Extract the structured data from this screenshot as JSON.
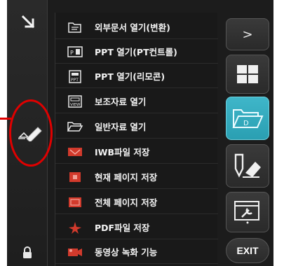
{
  "menu": {
    "items": [
      {
        "label": "외부문서 열기(변환)",
        "icon": "open-external-doc-icon"
      },
      {
        "label": "PPT 열기(PT컨트롤)",
        "icon": "ppt-control-icon"
      },
      {
        "label": "PPT 열기(리모콘)",
        "icon": "ppt-remote-icon"
      },
      {
        "label": "보조자료 열기",
        "icon": "supplementary-material-icon"
      },
      {
        "label": "일반자료 열기",
        "icon": "folder-icon"
      },
      {
        "label": "IWB파일 저장",
        "icon": "iwb-file-icon"
      },
      {
        "label": "현재 페이지 저장",
        "icon": "current-page-save-icon"
      },
      {
        "label": "전체 페이지 저장",
        "icon": "all-pages-save-icon"
      },
      {
        "label": "PDF파일 저장",
        "icon": "pdf-icon"
      },
      {
        "label": "동영상 녹화 기능",
        "icon": "video-record-icon"
      }
    ]
  },
  "toolbar": {
    "expand_label": ">",
    "exit_label": "EXIT",
    "buttons": [
      "windows-icon",
      "folder-icon",
      "pen-eraser-icon",
      "settings-icon"
    ]
  },
  "colors": {
    "active_button": "#2fa9bc",
    "annotation": "#e00000",
    "icon_red": "#d23a2c"
  }
}
